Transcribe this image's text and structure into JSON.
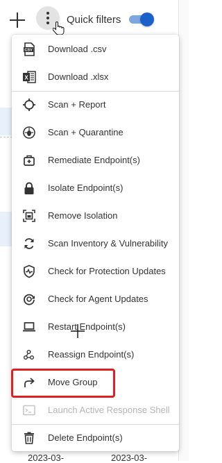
{
  "toolbar": {
    "add_icon": "plus-icon",
    "more_icon": "kebab-menu-icon",
    "quick_filters_label": "Quick filters",
    "quick_filters_on": true
  },
  "menu": {
    "items": [
      {
        "label": "Download .csv",
        "icon": "csv-file-icon"
      },
      {
        "label": "Download .xlsx",
        "icon": "excel-file-icon"
      },
      {
        "label": "Scan + Report",
        "icon": "crosshair-icon"
      },
      {
        "label": "Scan + Quarantine",
        "icon": "bug-icon"
      },
      {
        "label": "Remediate Endpoint(s)",
        "icon": "first-aid-kit-icon"
      },
      {
        "label": "Isolate Endpoint(s)",
        "icon": "lock-icon"
      },
      {
        "label": "Remove Isolation",
        "icon": "remove-isolation-icon"
      },
      {
        "label": "Scan Inventory & Vulnerability",
        "icon": "refresh-icon"
      },
      {
        "label": "Check for Protection Updates",
        "icon": "shield-pulse-icon"
      },
      {
        "label": "Check for Agent Updates",
        "icon": "agent-update-icon"
      },
      {
        "label": "Restart Endpoint(s)",
        "icon": "laptop-icon"
      },
      {
        "label": "Reassign Endpoint(s)",
        "icon": "reassign-icon"
      },
      {
        "label": "Move Group",
        "icon": "forward-arrow-icon"
      },
      {
        "label": "Launch Active Response Shell",
        "icon": "terminal-icon",
        "disabled": true
      },
      {
        "label": "Delete Endpoint(s)",
        "icon": "trash-icon"
      }
    ]
  },
  "background": {
    "date_1": "2023-03-",
    "date_2": "2023-03-"
  },
  "colors": {
    "accent": "#1a62c9",
    "highlight": "#e02020",
    "disabled_text": "#b5b5b5"
  }
}
